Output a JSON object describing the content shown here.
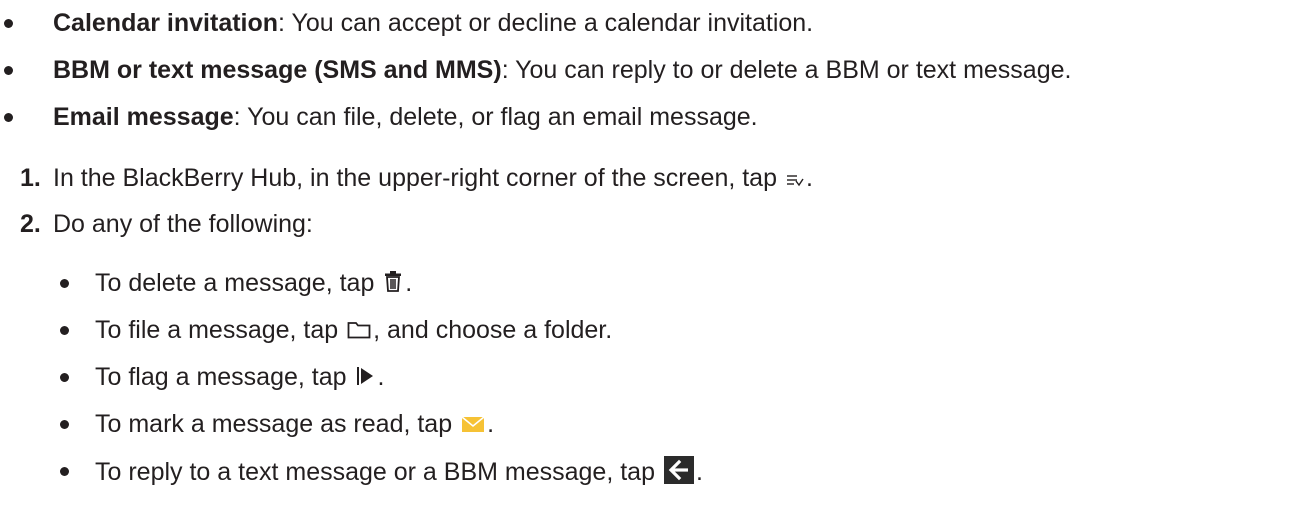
{
  "bullets": [
    {
      "term": "Calendar invitation",
      "desc": ": You can accept or decline a calendar invitation."
    },
    {
      "term": "BBM or text message (SMS and MMS)",
      "desc": ": You can reply to or delete a BBM or text message."
    },
    {
      "term": "Email message",
      "desc": ": You can file, delete, or flag an email message."
    }
  ],
  "steps": [
    {
      "num": "1.",
      "before": "In the BlackBerry Hub, in the upper-right corner of the screen, tap ",
      "icon": "select-more-icon",
      "after": "."
    },
    {
      "num": "2.",
      "text": "Do any of the following:"
    }
  ],
  "substeps": [
    {
      "before": "To delete a message, tap ",
      "icon": "trash-icon",
      "after": "."
    },
    {
      "before": "To file a message, tap ",
      "icon": "folder-icon",
      "after": ", and choose a folder."
    },
    {
      "before": "To flag a message, tap ",
      "icon": "flag-icon",
      "after": "."
    },
    {
      "before": "To mark a message as read, tap ",
      "icon": "envelope-icon",
      "after": "."
    },
    {
      "before": "To reply to a text message or a BBM message, tap ",
      "icon": "reply-arrow-icon",
      "after": "."
    }
  ],
  "colors": {
    "text": "#231f20",
    "envelope": "#f6c235",
    "reply_bg": "#2b2b2b"
  }
}
